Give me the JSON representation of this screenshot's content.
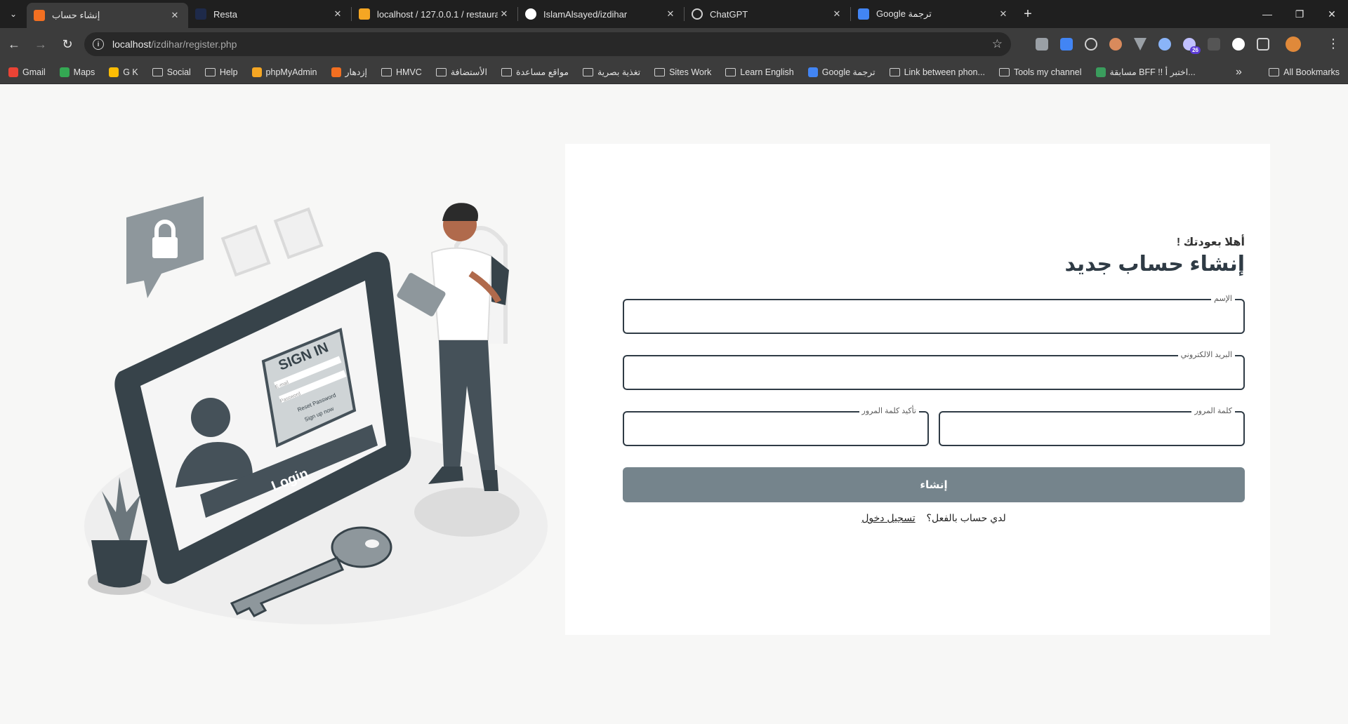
{
  "tabs": [
    {
      "title": "إنشاء حساب",
      "icon_color": "#f26f21",
      "active": true
    },
    {
      "title": "Resta",
      "icon_color": "#4f6fc2",
      "active": false
    },
    {
      "title": "localhost / 127.0.0.1 / restauran",
      "icon_color": "#f5a623",
      "active": false
    },
    {
      "title": "IslamAlsayed/izdihar",
      "icon_color": "#ffffff",
      "active": false
    },
    {
      "title": "ChatGPT",
      "icon_color": "#cfcfcf",
      "active": false
    },
    {
      "title": "ترجمة Google",
      "icon_color": "#4285f4",
      "active": false
    }
  ],
  "address_bar": {
    "host": "localhost",
    "path": "/izdihar/register.php"
  },
  "bookmarks": [
    {
      "label": "Gmail",
      "type": "site",
      "icon_color": "#ea4335"
    },
    {
      "label": "Maps",
      "type": "site",
      "icon_color": "#34a853"
    },
    {
      "label": "G K",
      "type": "site",
      "icon_color": "#fbbc04"
    },
    {
      "label": "Social",
      "type": "folder"
    },
    {
      "label": "Help",
      "type": "folder"
    },
    {
      "label": "phpMyAdmin",
      "type": "site",
      "icon_color": "#f5a623"
    },
    {
      "label": "إزدهار",
      "type": "site",
      "icon_color": "#f26f21"
    },
    {
      "label": "HMVC",
      "type": "folder"
    },
    {
      "label": "الأستضافة",
      "type": "folder"
    },
    {
      "label": "مواقع مساعدة",
      "type": "folder"
    },
    {
      "label": "تغذية بصرية",
      "type": "folder"
    },
    {
      "label": "Sites Work",
      "type": "folder"
    },
    {
      "label": "Learn English",
      "type": "folder"
    },
    {
      "label": "Google ترجمة",
      "type": "site",
      "icon_color": "#4285f4"
    },
    {
      "label": "Link between phon...",
      "type": "folder"
    },
    {
      "label": "Tools my channel",
      "type": "folder"
    },
    {
      "label": "مسابقة BFF !! اختبر أ...",
      "type": "site",
      "icon_color": "#3a9d5d"
    }
  ],
  "all_bookmarks_label": "All Bookmarks",
  "extension_badge": "26",
  "form": {
    "welcome": "أهلا بعودتك !",
    "title": "إنشاء حساب جديد",
    "name_label": "الإسم",
    "email_label": "البريد الالكتروني",
    "password_label": "كلمة المرور",
    "confirm_label": "تأكيد كلمة المرور",
    "submit_label": "إنشاء",
    "have_account": "لدي حساب بالفعل؟",
    "login_link": "تسجيل دخول"
  },
  "illustration": {
    "screen_title": "SIGN IN",
    "email_placeholder": "E-mail",
    "password_placeholder": "Password",
    "reset_text": "Reset Password",
    "signup_text": "Sign up now",
    "login_button": "Login"
  }
}
